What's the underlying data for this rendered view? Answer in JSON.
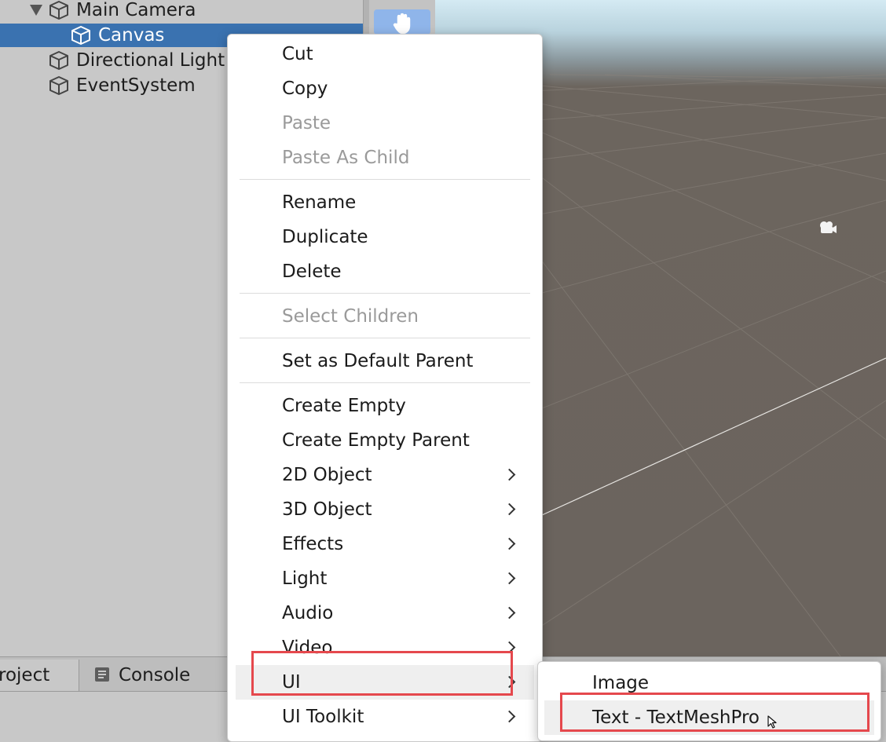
{
  "hierarchy": {
    "items": [
      {
        "label": "Main Camera",
        "icon": "cube-icon",
        "expanded": true
      },
      {
        "label": "Canvas",
        "icon": "cube-icon",
        "selected": true
      },
      {
        "label": "Directional Light",
        "icon": "cube-icon"
      },
      {
        "label": "EventSystem",
        "icon": "cube-icon"
      }
    ]
  },
  "scene": {
    "tool": "hand-icon",
    "gizmo": "camera-icon"
  },
  "bottom_tabs": {
    "project": "roject",
    "console": "Console",
    "console_icon": "console-icon"
  },
  "context_menu": {
    "items": [
      {
        "label": "Cut"
      },
      {
        "label": "Copy"
      },
      {
        "label": "Paste",
        "disabled": true
      },
      {
        "label": "Paste As Child",
        "disabled": true
      },
      {
        "label": "Rename"
      },
      {
        "label": "Duplicate"
      },
      {
        "label": "Delete"
      },
      {
        "label": "Select Children",
        "disabled": true
      },
      {
        "label": "Set as Default Parent"
      },
      {
        "label": "Create Empty"
      },
      {
        "label": "Create Empty Parent"
      },
      {
        "label": "2D Object",
        "submenu": true
      },
      {
        "label": "3D Object",
        "submenu": true
      },
      {
        "label": "Effects",
        "submenu": true
      },
      {
        "label": "Light",
        "submenu": true
      },
      {
        "label": "Audio",
        "submenu": true
      },
      {
        "label": "Video",
        "submenu": true
      },
      {
        "label": "UI",
        "submenu": true,
        "highlighted": true
      },
      {
        "label": "UI Toolkit",
        "submenu": true
      }
    ]
  },
  "ui_submenu": {
    "items": [
      {
        "label": "Image"
      },
      {
        "label": "Text - TextMeshPro",
        "highlighted": true
      }
    ]
  },
  "colors": {
    "selection": "#3a72b0",
    "annotation": "#e5484d",
    "menu_bg": "#ffffff",
    "scene_ground": "#6b645e"
  }
}
